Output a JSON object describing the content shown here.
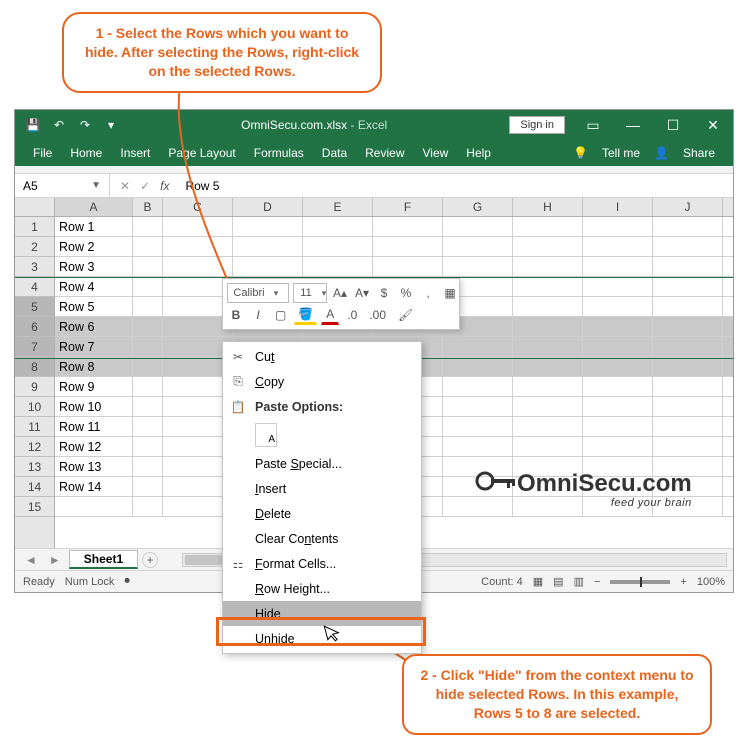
{
  "callout1": "1  - Select the Rows which you want to hide. After selecting the Rows, right-click on the selected Rows.",
  "callout2": "2 - Click \"Hide\" from the context menu to hide selected Rows. In this example, Rows 5 to 8 are selected.",
  "titlebar": {
    "filename": "OmniSecu.com.xlsx",
    "app": "Excel",
    "signin": "Sign in"
  },
  "ribbon": [
    "File",
    "Home",
    "Insert",
    "Page Layout",
    "Formulas",
    "Data",
    "Review",
    "View",
    "Help"
  ],
  "ribbon_right": {
    "tellme": "Tell me",
    "share": "Share"
  },
  "namebox": "A5",
  "formula": "Row 5",
  "columns": [
    "A",
    "B",
    "C",
    "D",
    "E",
    "F",
    "G",
    "H",
    "I",
    "J"
  ],
  "rows": [
    {
      "n": "1",
      "a": "Row 1"
    },
    {
      "n": "2",
      "a": "Row 2"
    },
    {
      "n": "3",
      "a": "Row 3"
    },
    {
      "n": "4",
      "a": "Row 4"
    },
    {
      "n": "5",
      "a": "Row 5",
      "sel": true,
      "first": true
    },
    {
      "n": "6",
      "a": "Row 6",
      "sel": true
    },
    {
      "n": "7",
      "a": "Row 7",
      "sel": true
    },
    {
      "n": "8",
      "a": "Row 8",
      "sel": true
    },
    {
      "n": "9",
      "a": "Row 9"
    },
    {
      "n": "10",
      "a": "Row 10"
    },
    {
      "n": "11",
      "a": "Row 11"
    },
    {
      "n": "12",
      "a": "Row 12"
    },
    {
      "n": "13",
      "a": "Row 13"
    },
    {
      "n": "14",
      "a": "Row 14"
    },
    {
      "n": "15",
      "a": ""
    }
  ],
  "minitoolbar": {
    "font": "Calibri",
    "size": "11"
  },
  "context_menu": {
    "cut": "Cut",
    "copy": "Copy",
    "paste_options": "Paste Options:",
    "paste_special": "Paste Special...",
    "insert": "Insert",
    "delete": "Delete",
    "clear": "Clear Contents",
    "format": "Format Cells...",
    "row_height": "Row Height...",
    "hide": "Hide",
    "unhide": "Unhide"
  },
  "sheet_tab": "Sheet1",
  "status": {
    "ready": "Ready",
    "numlock": "Num Lock",
    "count": "Count: 4",
    "zoom": "100%"
  },
  "logo": {
    "name": "OmniSecu.com",
    "tag": "feed your brain"
  }
}
